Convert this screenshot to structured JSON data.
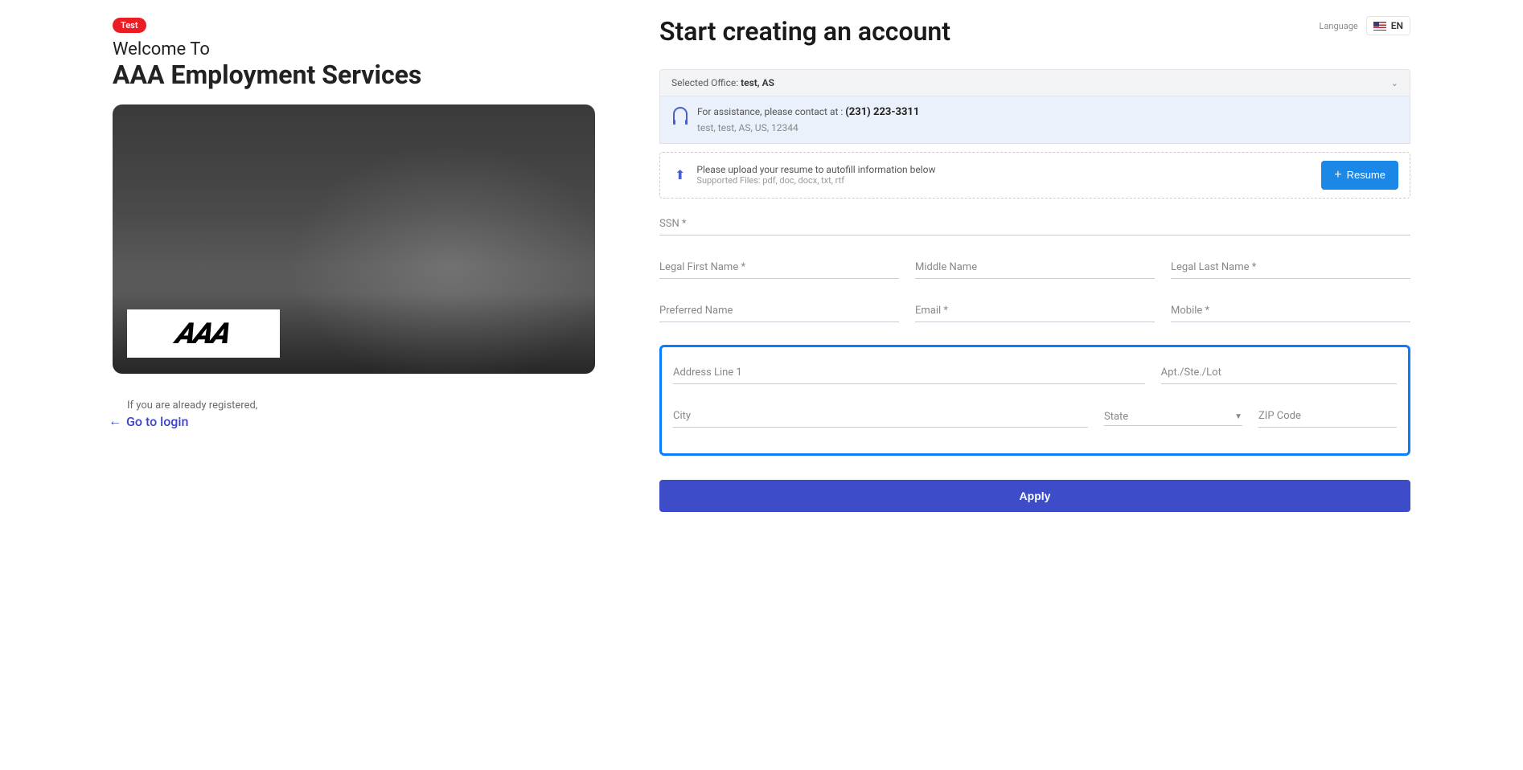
{
  "left": {
    "badge": "Test",
    "welcome": "Welcome To",
    "company": "AAA Employment Services",
    "logo": "AAA",
    "already_registered": "If you are already registered,",
    "login_link": "Go to login"
  },
  "header": {
    "title": "Start creating an account",
    "language_label": "Language",
    "language_value": "EN"
  },
  "office": {
    "label": "Selected Office: ",
    "value": "test, AS"
  },
  "assistance": {
    "prefix": "For assistance, please contact at : ",
    "phone": "(231) 223-3311",
    "address": "test, test, AS, US, 12344"
  },
  "upload": {
    "main": "Please upload your resume to autofill information below",
    "sub": "Supported Files: pdf, doc, docx, txt, rtf",
    "button": "Resume"
  },
  "fields": {
    "ssn": "SSN *",
    "first_name": "Legal First Name *",
    "middle_name": "Middle Name",
    "last_name": "Legal Last Name *",
    "preferred_name": "Preferred Name",
    "email": "Email *",
    "mobile": "Mobile *",
    "address1": "Address Line 1",
    "apt": "Apt./Ste./Lot",
    "city": "City",
    "state": "State",
    "zip": "ZIP Code"
  },
  "apply_button": "Apply"
}
